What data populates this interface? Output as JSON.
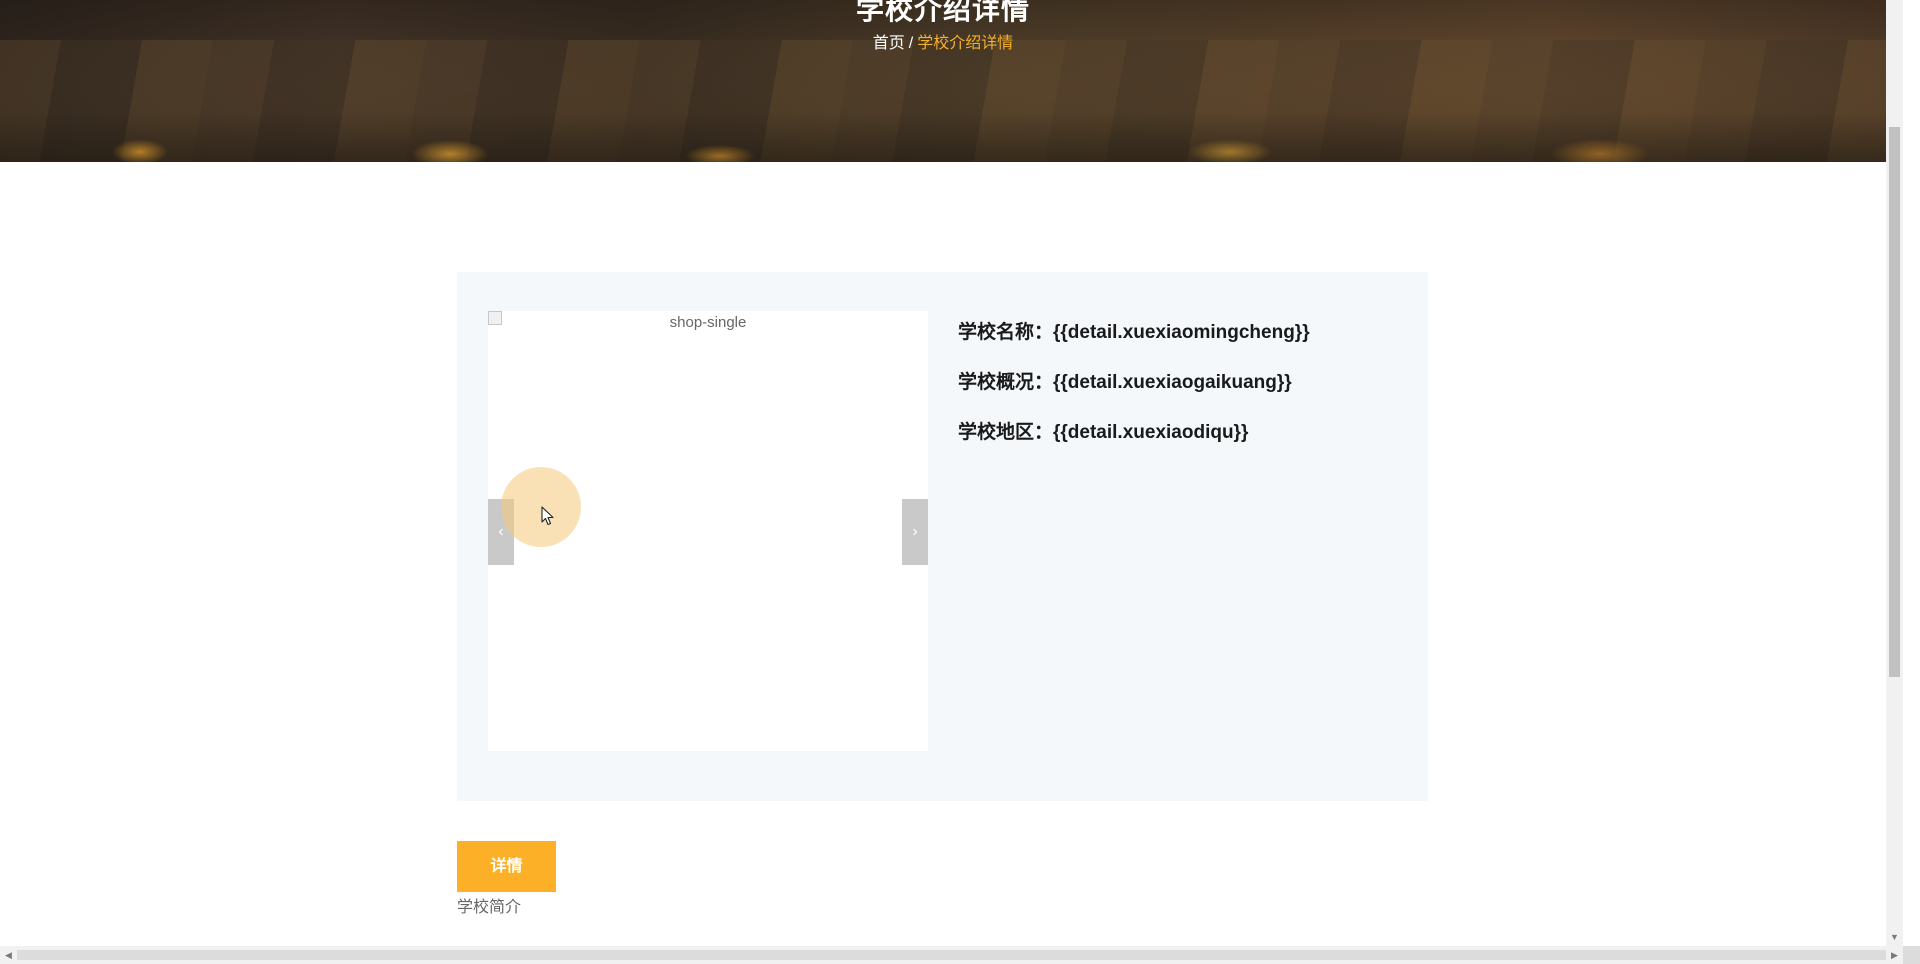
{
  "hero": {
    "title": "学校介绍详情",
    "breadcrumb": {
      "home": "首页",
      "separator": "/",
      "current": "学校介绍详情"
    }
  },
  "product": {
    "image_alt": "shop-single",
    "prev_arrow": "‹",
    "next_arrow": "›",
    "fields": [
      {
        "label": "学校名称：",
        "value": "{{detail.xuexiaomingcheng}}"
      },
      {
        "label": "学校概况：",
        "value": "{{detail.xuexiaogaikuang}}"
      },
      {
        "label": "学校地区：",
        "value": "{{detail.xuexiaodiqu}}"
      }
    ]
  },
  "tabs": {
    "detail_button": "详情",
    "intro_label": "学校简介"
  },
  "scrollbar": {
    "down_arrow": "▼",
    "left_arrow": "◀",
    "right_arrow": "▶"
  },
  "colors": {
    "accent": "#fbb028",
    "breadcrumb_current": "#f6b12a",
    "card_bg": "#f4f8fb"
  }
}
